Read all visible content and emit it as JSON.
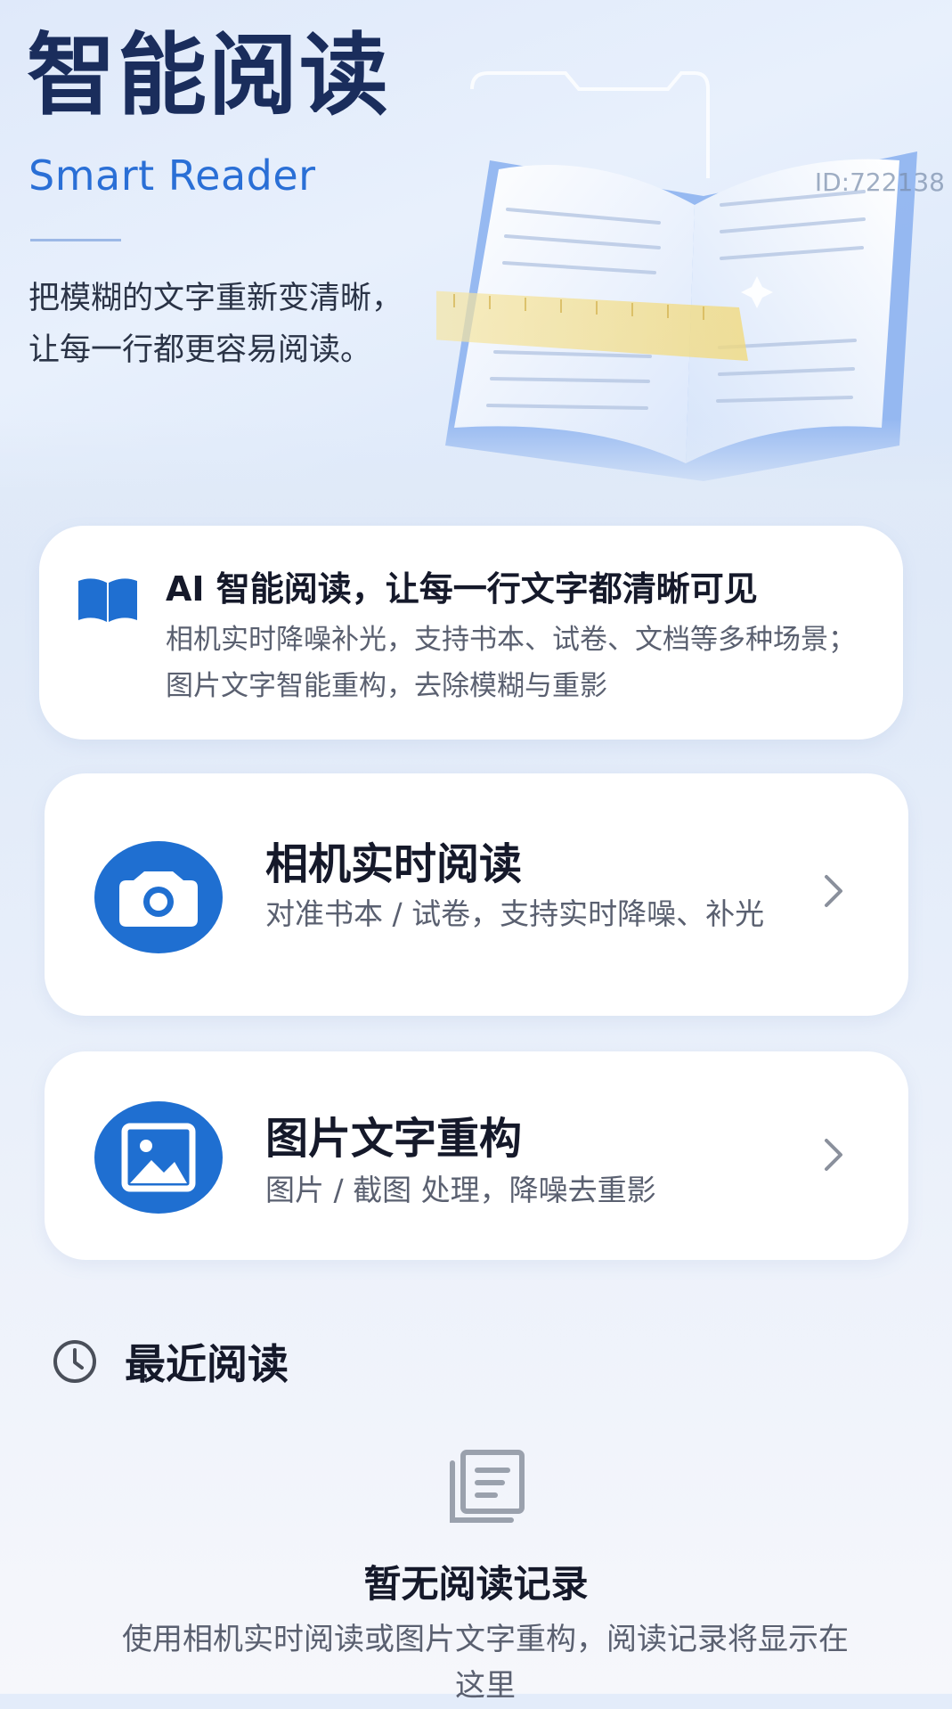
{
  "hero": {
    "title": "智能阅读",
    "subtitle": "Smart Reader",
    "desc_line1": "把模糊的文字重新变清晰，",
    "desc_line2": "让每一行都更容易阅读。",
    "id_text": "ID:722138"
  },
  "intro": {
    "icon": "open-book-icon",
    "title": "AI 智能阅读，让每一行文字都清晰可见",
    "desc": "相机实时降噪补光，支持书本、试卷、文档等多种场景；图片文字智能重构，去除模糊与重影"
  },
  "features": [
    {
      "icon": "camera-icon",
      "title": "相机实时阅读",
      "desc": "对准书本 / 试卷，支持实时降噪、补光"
    },
    {
      "icon": "image-icon",
      "title": "图片文字重构",
      "desc": "图片 / 截图 处理，降噪去重影"
    }
  ],
  "recent": {
    "icon": "clock-icon",
    "title": "最近阅读",
    "empty_icon": "document-list-icon",
    "empty_title": "暂无阅读记录",
    "empty_desc": "使用相机实时阅读或图片文字重构，阅读记录将显示在这里"
  },
  "colors": {
    "accent": "#1f6fd1",
    "title_dark": "#1a2d5c",
    "subtitle_blue": "#2a6fd6"
  }
}
